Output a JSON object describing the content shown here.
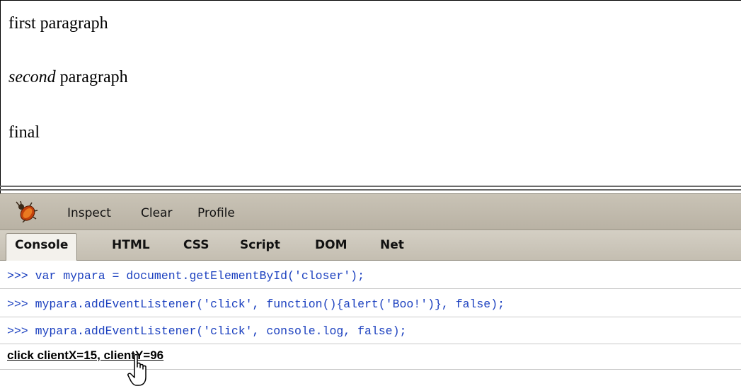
{
  "page": {
    "paragraphs": [
      {
        "em": "",
        "text": "first paragraph"
      },
      {
        "em": "second",
        "text": " paragraph"
      },
      {
        "em": "",
        "text": "final"
      }
    ]
  },
  "firebug": {
    "toolbar": {
      "inspect": "Inspect",
      "clear": "Clear",
      "profile": "Profile"
    },
    "tabs": [
      "Console",
      "HTML",
      "CSS",
      "Script",
      "DOM",
      "Net"
    ],
    "active_tab": "Console",
    "console_lines": [
      ">>> var mypara = document.getElementById('closer');",
      ">>> mypara.addEventListener('click', function(){alert('Boo!')}, false);",
      ">>> mypara.addEventListener('click', console.log, false);"
    ],
    "output": "click clientX=15, clientY=96",
    "colors": {
      "command": "#1a3fbf",
      "toolbar": "#c9c3b6"
    },
    "icons": {
      "logo": "firebug-icon",
      "cursor": "hand-pointer-icon"
    }
  }
}
